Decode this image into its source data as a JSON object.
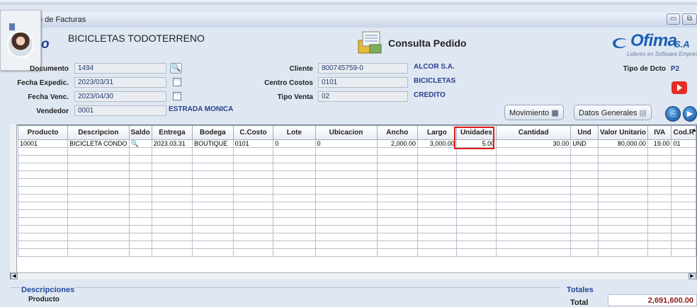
{
  "window": {
    "title": "o de Facturas"
  },
  "header": {
    "company_fragment": "o",
    "company_name": "BICICLETAS TODOTERRENO",
    "screen_title": "Consulta Pedido",
    "logo_text": "Ofima",
    "logo_suffix": "S.A",
    "logo_tagline": "Lideres en Software Empresarial"
  },
  "form": {
    "documento": {
      "label": "Documento",
      "value": "1494"
    },
    "fecha_expedic": {
      "label": "Fecha Expedic.",
      "value": "2023/03/31"
    },
    "fecha_venc": {
      "label": "Fecha Venc.",
      "value": "2023/04/30"
    },
    "vendedor": {
      "label": "Vendedor",
      "value": "0001",
      "name": "ESTRADA MONICA"
    },
    "cliente": {
      "label": "Cliente",
      "value": "800745759-0",
      "name": "ALCOR S.A."
    },
    "centro_costos": {
      "label": "Centro Costos",
      "value": "0101",
      "name": "BICICLETAS"
    },
    "tipo_venta": {
      "label": "Tipo Venta",
      "value": "02",
      "name": "CREDITO"
    },
    "tipo_dcto": {
      "label": "Tipo de Dcto",
      "value": "P2"
    }
  },
  "buttons": {
    "movimiento": "Movimiento",
    "datos_generales": "Datos Generales"
  },
  "grid": {
    "columns": [
      "Producto",
      "Descripcion",
      "Saldo",
      "Entrega",
      "Bodega",
      "C.Costo",
      "Lote",
      "Ubicacion",
      "Ancho",
      "Largo",
      "Unidades",
      "Cantidad",
      "Und",
      "Valor Unitario",
      "IVA",
      "Cod.R"
    ],
    "rows": [
      [
        "10001",
        "BICICLETA CONDO",
        "",
        "2023.03.31",
        "BOUTIQUE",
        "0101",
        "0",
        "0",
        "2,000.00",
        "3,000.00",
        "5.00",
        "30.00",
        "UND",
        "80,000.00",
        "19.00",
        "01"
      ]
    ]
  },
  "bottom": {
    "descripciones": "Descripciones",
    "producto": "Producto",
    "totales": "Totales",
    "total_label": "Total",
    "total_value": "2,691,600.00"
  },
  "colors": {
    "accent": "#1f4a9c",
    "highlight": "#e11b1b",
    "total_value": "#8b1a1a"
  },
  "icons": [
    "search-icon",
    "calendar-icon",
    "grid-icon",
    "document-icon",
    "youtube-icon",
    "clip-icon",
    "play-icon",
    "minimize-icon",
    "restore-icon"
  ]
}
